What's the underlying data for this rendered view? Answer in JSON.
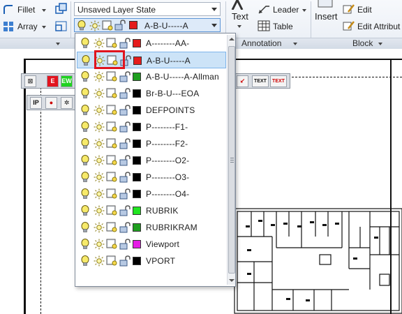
{
  "ribbon": {
    "fillet_label": "Fillet",
    "array_label": "Array",
    "layer_state_value": "Unsaved Layer State",
    "current_layer_name": "A-B-U-----A",
    "current_layer_color": "#e51c1c",
    "text_label": "Text",
    "leader_label": "Leader",
    "table_label": "Table",
    "insert_label": "Insert",
    "edit_label": "Edit",
    "edit_attributes_label": "Edit Attribut",
    "annotation_panel_title": "Annotation",
    "block_panel_title": "Block"
  },
  "floating_toolbar_1": {
    "buttons": [
      "E",
      "EW"
    ]
  },
  "floating_toolbar_2": {
    "buttons": [
      "IP"
    ]
  },
  "text_toolbar": {
    "buttons": [
      "TEXT",
      "TEXT"
    ]
  },
  "layer_dropdown": {
    "highlight_color": "#e0141e",
    "layers": [
      {
        "name": "A--------AA-",
        "color": "#e51c1c",
        "selected": false
      },
      {
        "name": "A-B-U-----A",
        "color": "#e51c1c",
        "selected": true
      },
      {
        "name": "A-B-U-----A-Allman",
        "color": "#1f9e1f",
        "selected": false
      },
      {
        "name": "Br-B-U---EOA",
        "color": "#000000",
        "selected": false
      },
      {
        "name": "DEFPOINTS",
        "color": "#000000",
        "selected": false
      },
      {
        "name": "P--------F1-",
        "color": "#000000",
        "selected": false
      },
      {
        "name": "P--------F2-",
        "color": "#000000",
        "selected": false
      },
      {
        "name": "P--------O2-",
        "color": "#000000",
        "selected": false
      },
      {
        "name": "P--------O3-",
        "color": "#000000",
        "selected": false
      },
      {
        "name": "P--------O4-",
        "color": "#000000",
        "selected": false
      },
      {
        "name": "RUBRIK",
        "color": "#22e522",
        "selected": false
      },
      {
        "name": "RUBRIKRAM",
        "color": "#1f9e1f",
        "selected": false
      },
      {
        "name": "Viewport",
        "color": "#e51ce5",
        "selected": false
      },
      {
        "name": "VPORT",
        "color": "#000000",
        "selected": false
      }
    ]
  }
}
